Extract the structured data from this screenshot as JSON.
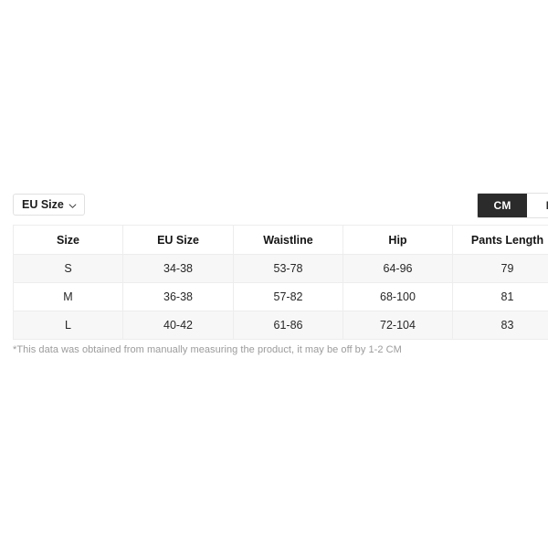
{
  "toolbar": {
    "size_system_label": "EU Size",
    "size_system_icon": "chevron-down-icon",
    "units": [
      {
        "label": "CM",
        "active": true
      },
      {
        "label": "IN",
        "active": false
      }
    ]
  },
  "table": {
    "columns": [
      "Size",
      "EU Size",
      "Waistline",
      "Hip",
      "Pants Length",
      ""
    ],
    "rows": [
      {
        "size": "S",
        "eu_size": "34-38",
        "waistline": "53-78",
        "hip": "64-96",
        "pants_length": "79",
        "extra": ""
      },
      {
        "size": "M",
        "eu_size": "36-38",
        "waistline": "57-82",
        "hip": "68-100",
        "pants_length": "81",
        "extra": ""
      },
      {
        "size": "L",
        "eu_size": "40-42",
        "waistline": "61-86",
        "hip": "72-104",
        "pants_length": "83",
        "extra": ""
      }
    ]
  },
  "footnote": {
    "text": "*This data was obtained from manually measuring the product, it may be off by 1-2 CM"
  },
  "colors": {
    "toggle_active_bg": "#2b2b2b",
    "toggle_active_text": "#ffffff",
    "row_stripe": "#f7f7f7",
    "border": "#ededed",
    "footnote_text": "#9b9b9b"
  }
}
